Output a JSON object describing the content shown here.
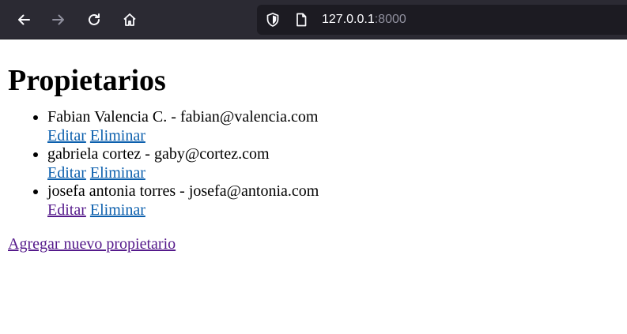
{
  "browser": {
    "url_host": "127.0.0.1",
    "url_port": ":8000"
  },
  "page": {
    "title": "Propietarios",
    "owners": [
      {
        "name": "Fabian Valencia C.",
        "email": "fabian@valencia.com",
        "edit_label": "Editar",
        "delete_label": "Eliminar"
      },
      {
        "name": "gabriela cortez",
        "email": "gaby@cortez.com",
        "edit_label": "Editar",
        "delete_label": "Eliminar"
      },
      {
        "name": "josefa antonia torres",
        "email": "josefa@antonia.com",
        "edit_label": "Editar",
        "delete_label": "Eliminar"
      }
    ],
    "separator": " - ",
    "add_link_label": "Agregar nuevo propietario"
  },
  "colors": {
    "link": "#0b5fad",
    "visited_link": "#551a8b",
    "toolbar_bg": "#2b2a33",
    "urlbar_bg": "#1c1b22"
  }
}
